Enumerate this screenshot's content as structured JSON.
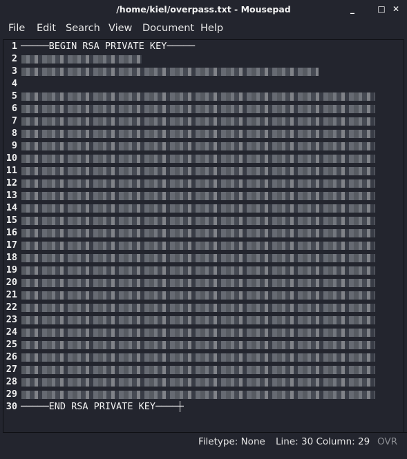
{
  "window": {
    "title": "/home/kiel/overpass.txt - Mousepad",
    "controls": {
      "minimize": "_",
      "maximize": "□",
      "close": "✕"
    }
  },
  "menubar": {
    "items": [
      "File",
      "Edit",
      "Search",
      "View",
      "Document",
      "Help"
    ]
  },
  "editor": {
    "lines": [
      {
        "number": "1",
        "text": "─────BEGIN RSA PRIVATE KEY─────",
        "redacted": false
      },
      {
        "number": "2",
        "text": "",
        "redacted": true,
        "redact_fraction": 0.34
      },
      {
        "number": "3",
        "text": "",
        "redacted": true,
        "redact_fraction": 0.84
      },
      {
        "number": "4",
        "text": "",
        "redacted": false
      },
      {
        "number": "5",
        "text": "",
        "redacted": true,
        "redact_fraction": 1.0
      },
      {
        "number": "6",
        "text": "",
        "redacted": true,
        "redact_fraction": 1.0
      },
      {
        "number": "7",
        "text": "",
        "redacted": true,
        "redact_fraction": 1.0
      },
      {
        "number": "8",
        "text": "",
        "redacted": true,
        "redact_fraction": 1.0
      },
      {
        "number": "9",
        "text": "",
        "redacted": true,
        "redact_fraction": 1.0
      },
      {
        "number": "10",
        "text": "",
        "redacted": true,
        "redact_fraction": 1.0
      },
      {
        "number": "11",
        "text": "",
        "redacted": true,
        "redact_fraction": 1.0
      },
      {
        "number": "12",
        "text": "",
        "redacted": true,
        "redact_fraction": 1.0
      },
      {
        "number": "13",
        "text": "",
        "redacted": true,
        "redact_fraction": 1.0
      },
      {
        "number": "14",
        "text": "",
        "redacted": true,
        "redact_fraction": 1.0
      },
      {
        "number": "15",
        "text": "",
        "redacted": true,
        "redact_fraction": 1.0
      },
      {
        "number": "16",
        "text": "",
        "redacted": true,
        "redact_fraction": 1.0
      },
      {
        "number": "17",
        "text": "",
        "redacted": true,
        "redact_fraction": 1.0
      },
      {
        "number": "18",
        "text": "",
        "redacted": true,
        "redact_fraction": 1.0
      },
      {
        "number": "19",
        "text": "",
        "redacted": true,
        "redact_fraction": 1.0
      },
      {
        "number": "20",
        "text": "",
        "redacted": true,
        "redact_fraction": 1.0
      },
      {
        "number": "21",
        "text": "",
        "redacted": true,
        "redact_fraction": 1.0
      },
      {
        "number": "22",
        "text": "",
        "redacted": true,
        "redact_fraction": 1.0
      },
      {
        "number": "23",
        "text": "",
        "redacted": true,
        "redact_fraction": 1.0
      },
      {
        "number": "24",
        "text": "",
        "redacted": true,
        "redact_fraction": 1.0
      },
      {
        "number": "25",
        "text": "",
        "redacted": true,
        "redact_fraction": 1.0
      },
      {
        "number": "26",
        "text": "",
        "redacted": true,
        "redact_fraction": 1.0
      },
      {
        "number": "27",
        "text": "",
        "redacted": true,
        "redact_fraction": 1.0
      },
      {
        "number": "28",
        "text": "",
        "redacted": true,
        "redact_fraction": 1.0
      },
      {
        "number": "29",
        "text": "",
        "redacted": true,
        "redact_fraction": 1.0
      },
      {
        "number": "30",
        "text": "─────END RSA PRIVATE KEY─────",
        "redacted": false,
        "current": true
      }
    ]
  },
  "statusbar": {
    "filetype": "Filetype: None",
    "position": "Line: 30 Column: 29",
    "mode": "OVR"
  }
}
